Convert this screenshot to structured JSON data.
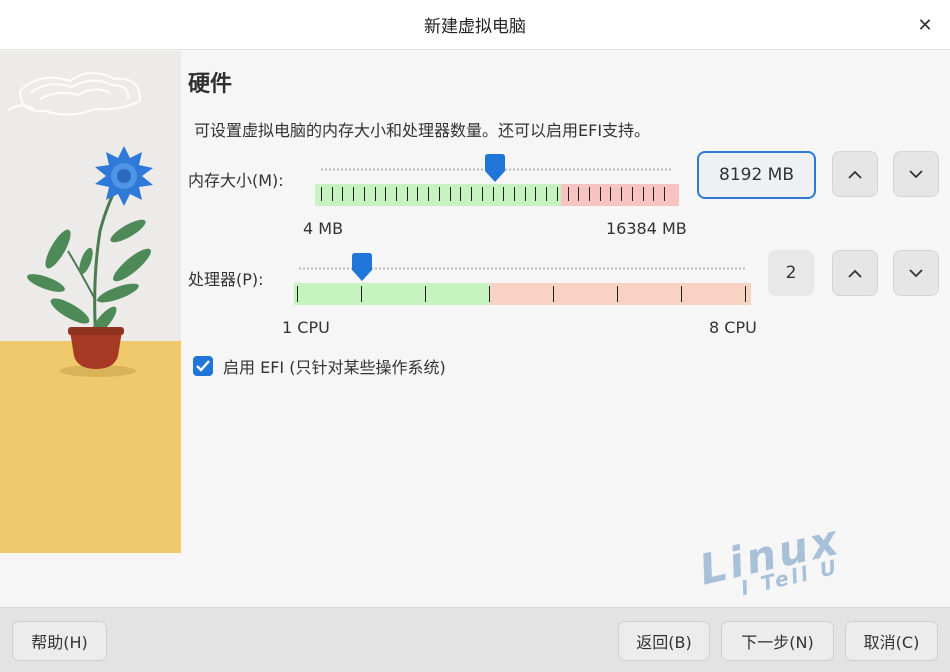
{
  "window": {
    "title": "新建虚拟电脑",
    "close_glyph": "✕"
  },
  "section": {
    "heading": "硬件",
    "description": "可设置虚拟电脑的内存大小和处理器数量。还可以启用EFI支持。"
  },
  "memory": {
    "label": "内存大小(M):",
    "value_text": "8192 MB",
    "min_label": "4 MB",
    "max_label": "16384 MB",
    "value_mb": 8192,
    "min_mb": 4,
    "max_mb": 16384
  },
  "processor": {
    "label": "处理器(P):",
    "value_text": "2",
    "min_label": "1 CPU",
    "max_label": "8 CPU",
    "value": 2,
    "min": 1,
    "max": 8
  },
  "efi": {
    "label": "启用 EFI (只针对某些操作系统)",
    "checked": true
  },
  "watermark": {
    "line1": "Linux",
    "line2": "I Tell U"
  },
  "footer": {
    "help": "帮助(H)",
    "back": "返回(B)",
    "next": "下一步(N)",
    "cancel": "取消(C)"
  },
  "colors": {
    "accent": "#1f75d8",
    "band_green": "#c6f3bf",
    "band_red": "#f7c4c1",
    "band_orange": "#f8d2c2",
    "sidebar_yellow": "#f0c96c"
  }
}
